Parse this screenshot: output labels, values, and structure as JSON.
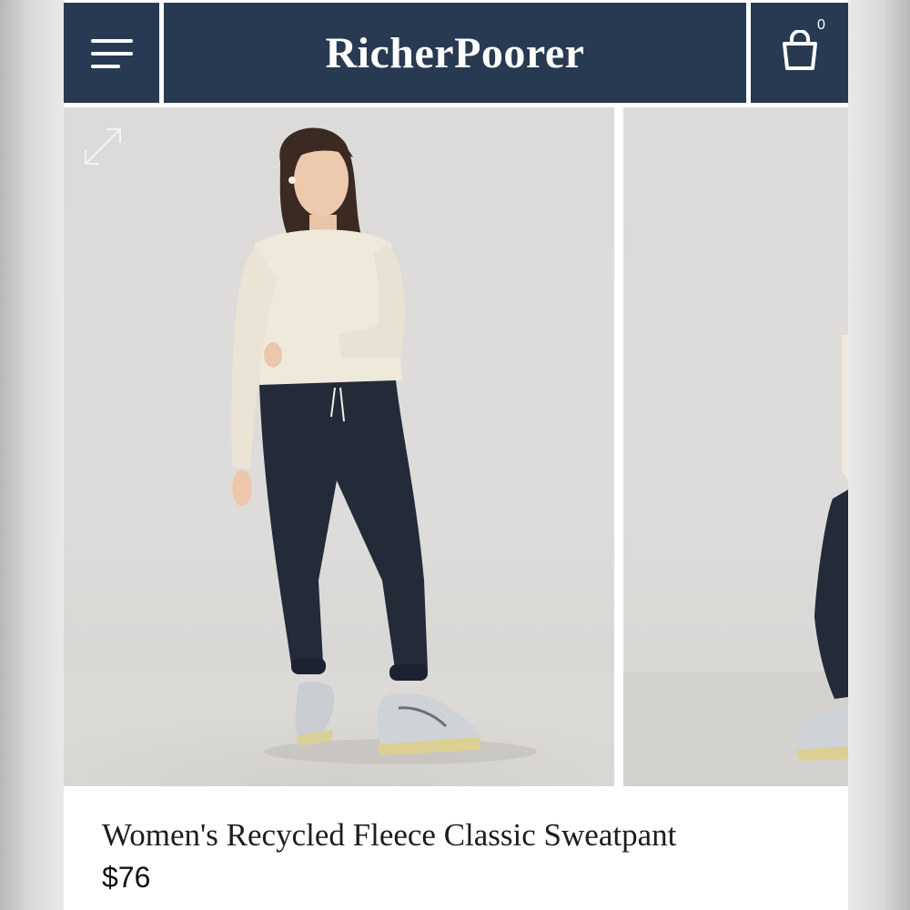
{
  "header": {
    "brand": "RicherPoorer",
    "cart_count": "0"
  },
  "icons": {
    "menu": "hamburger-icon",
    "cart": "shopping-bag-icon",
    "expand": "expand-icon"
  },
  "product": {
    "title": "Women's Recycled Fleece Classic Sweatpant",
    "price": "$76"
  },
  "colors": {
    "header_bg": "#283a52",
    "header_text": "#ffffff",
    "sweatshirt": "#efe9dc",
    "sweatpant": "#232a38"
  }
}
